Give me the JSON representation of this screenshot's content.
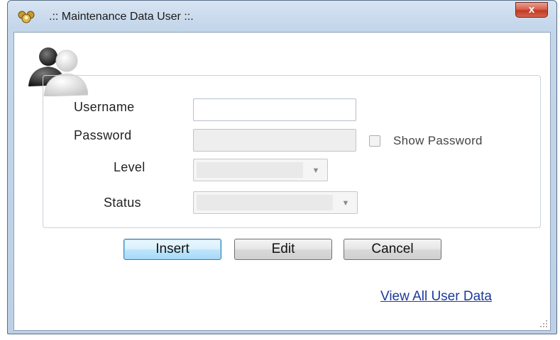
{
  "window": {
    "title": ".:: Maintenance Data User ::.",
    "close_label": "x",
    "app_icon": "users-group-icon"
  },
  "form": {
    "username": {
      "label": "Username",
      "value": ""
    },
    "password": {
      "label": "Password",
      "value": ""
    },
    "show_password": {
      "label": "Show Password",
      "checked": false
    },
    "level": {
      "label": "Level",
      "selected": ""
    },
    "status": {
      "label": "Status",
      "selected": ""
    }
  },
  "buttons": {
    "insert": "Insert",
    "edit": "Edit",
    "cancel": "Cancel"
  },
  "links": {
    "view_all": "View All User Data"
  },
  "colors": {
    "link": "#1b3a9c",
    "close_button": "#c23a22",
    "window_frame": "#bdd0e6"
  }
}
